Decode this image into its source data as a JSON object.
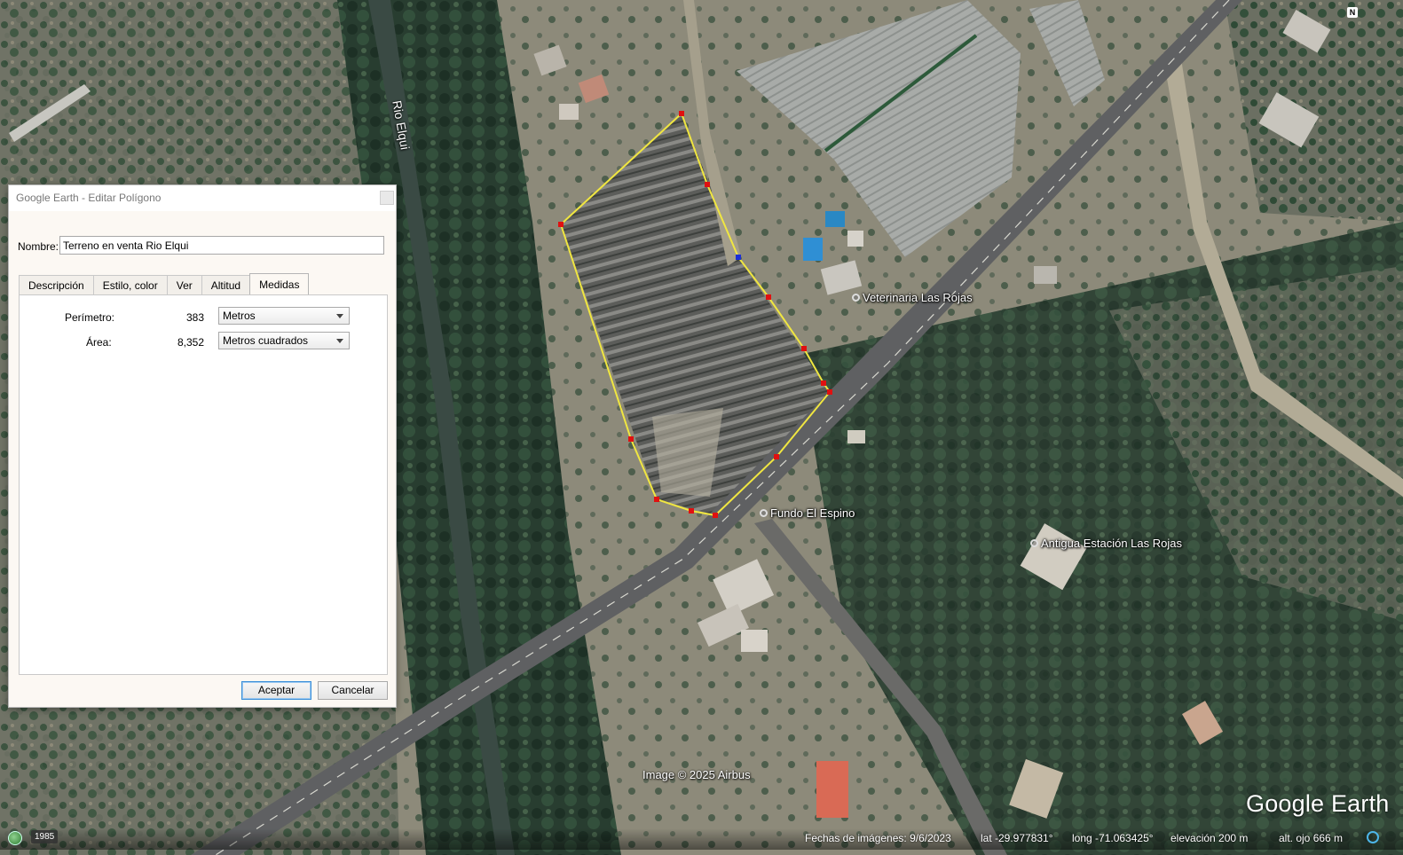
{
  "map": {
    "river_label": "Rio Elqui",
    "places": [
      {
        "id": "veterinaria",
        "label": "Veterinaria Las Rojas"
      },
      {
        "id": "fundo",
        "label": "Fundo El Espino"
      },
      {
        "id": "estacion",
        "label": "Antigua Estación Las Rojas"
      }
    ],
    "image_credit": "Image © 2025 Airbus",
    "logo": "Google Earth",
    "north_label": "N",
    "polygon_color": "#f0e641",
    "vertex_color": "#e01010",
    "selected_vertex_color": "#1a2fd6"
  },
  "statusbar": {
    "year": "1985",
    "imagery_date": "Fechas de imágenes: 9/6/2023",
    "lat": "lat  -29.977831°",
    "long": "long  -71.063425°",
    "elevation": "elevación   200 m",
    "eye_alt": "alt. ojo    666 m"
  },
  "dialog": {
    "title": "Google Earth - Editar Polígono",
    "name_label": "Nombre:",
    "name_value": "Terreno en venta Rio Elqui",
    "tabs": [
      {
        "label": "Descripción",
        "active": false
      },
      {
        "label": "Estilo, color",
        "active": false
      },
      {
        "label": "Ver",
        "active": false
      },
      {
        "label": "Altitud",
        "active": false
      },
      {
        "label": "Medidas",
        "active": true
      }
    ],
    "perimeter_label": "Perímetro:",
    "perimeter_value": "383",
    "perimeter_unit": "Metros",
    "area_label": "Área:",
    "area_value": "8,352",
    "area_unit": "Metros cuadrados",
    "accept_label": "Aceptar",
    "cancel_label": "Cancelar"
  }
}
